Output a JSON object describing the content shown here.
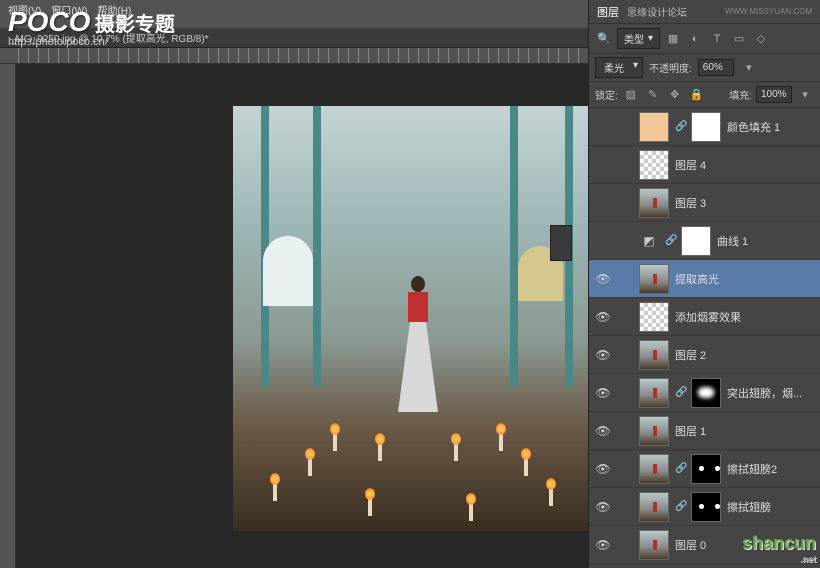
{
  "menu": {
    "view": "视图(V)",
    "window": "窗口(W)",
    "help": "帮助(H)"
  },
  "logo": {
    "brand": "POCO",
    "suffix": "摄影专题",
    "url": "http://photo.poco.cn/"
  },
  "docTab": "_MG_9250.jpg @ 10.7% (提取高光, RGB/8)*",
  "panel": {
    "tabLayers": "图层",
    "forum": "思缘设计论坛",
    "forumUrl": "WWW.MISSYUAN.COM",
    "filterLabel": "类型",
    "blendMode": "柔光",
    "opacityLabel": "不透明度:",
    "opacityVal": "60%",
    "lockLabel": "锁定:",
    "fillLabel": "填充:",
    "fillVal": "100%"
  },
  "layers": [
    {
      "vis": false,
      "type": "solid",
      "name": "颜色填充 1",
      "hasMask": true,
      "indent": 1
    },
    {
      "vis": false,
      "type": "checker",
      "name": "图层 4",
      "indent": 1
    },
    {
      "vis": false,
      "type": "img",
      "name": "图层 3",
      "indent": 1
    },
    {
      "vis": false,
      "type": "curves",
      "name": "曲线 1",
      "hasMask": true,
      "indent": 1
    },
    {
      "vis": true,
      "type": "img",
      "name": "提取高光",
      "selected": true,
      "indent": 1
    },
    {
      "vis": true,
      "type": "checker",
      "name": "添加烟雾效果",
      "indent": 1
    },
    {
      "vis": true,
      "type": "img",
      "name": "图层 2",
      "indent": 1
    },
    {
      "vis": true,
      "type": "img",
      "name": "突出翅膀，烟...",
      "mask": "mask",
      "indent": 1
    },
    {
      "vis": true,
      "type": "img",
      "name": "图层 1",
      "indent": 1
    },
    {
      "vis": true,
      "type": "img",
      "name": "擦拭翅膀2",
      "mask": "mask2",
      "indent": 1
    },
    {
      "vis": true,
      "type": "img",
      "name": "擦拭翅膀",
      "mask": "mask2",
      "indent": 1
    },
    {
      "vis": true,
      "type": "img",
      "name": "图层 0",
      "indent": 1
    }
  ],
  "watermark": {
    "text": "shancun",
    "sub": ".net"
  }
}
